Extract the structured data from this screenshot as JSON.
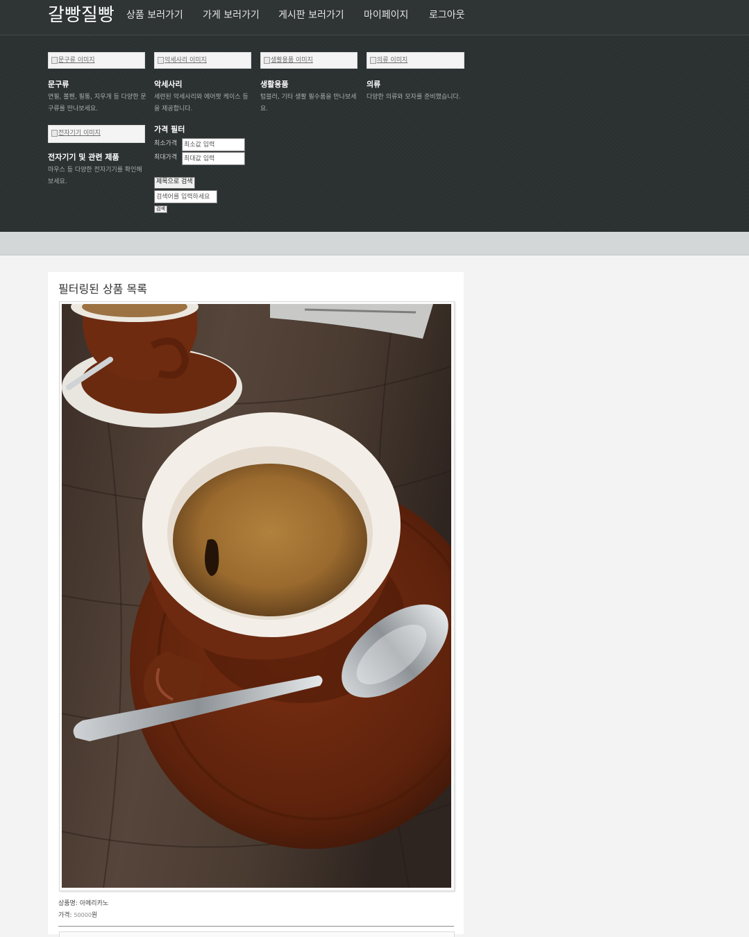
{
  "nav": {
    "brand": "갈빵질빵",
    "links": [
      "상품 보러가기",
      "가게 보러가기",
      "게시판 보러가기",
      "마이페이지",
      "로그아웃"
    ]
  },
  "categories": [
    {
      "img_alt": "문구류 이미지",
      "title": "문구류",
      "desc": "연필, 볼펜, 필통, 지우개 등 다양한 문구류를 만나보세요."
    },
    {
      "img_alt": "악세사리 이미지",
      "title": "악세사리",
      "desc": "세련된 악세사리와 에어팟 케이스 등을 제공합니다."
    },
    {
      "img_alt": "생활용품 이미지",
      "title": "생활용품",
      "desc": "텀블러, 기타 생활 필수품을 만나보세요."
    },
    {
      "img_alt": "의류 이미지",
      "title": "의류",
      "desc": "다양한 의류와 모자를 준비했습니다."
    },
    {
      "img_alt": "전자기기 이미지",
      "title": "전자기기 및 관련 제품",
      "desc": "마우스 등 다양한 전자기기를 확인해보세요."
    }
  ],
  "filter": {
    "title": "가격 필터",
    "min_label": "최소가격",
    "min_placeholder": "최소값 입력",
    "max_label": "최대가격",
    "max_placeholder": "최대값 입력",
    "title_search_button": "제목으로 검색",
    "search_placeholder": "검색어를 입력하세요",
    "search_button": "검색"
  },
  "results": {
    "heading": "필터링된 상품 목록",
    "items": [
      {
        "name_label": "상품명:",
        "name": "아메리카노",
        "price_label": "가격:",
        "price": "50000",
        "price_unit": "원"
      }
    ]
  }
}
